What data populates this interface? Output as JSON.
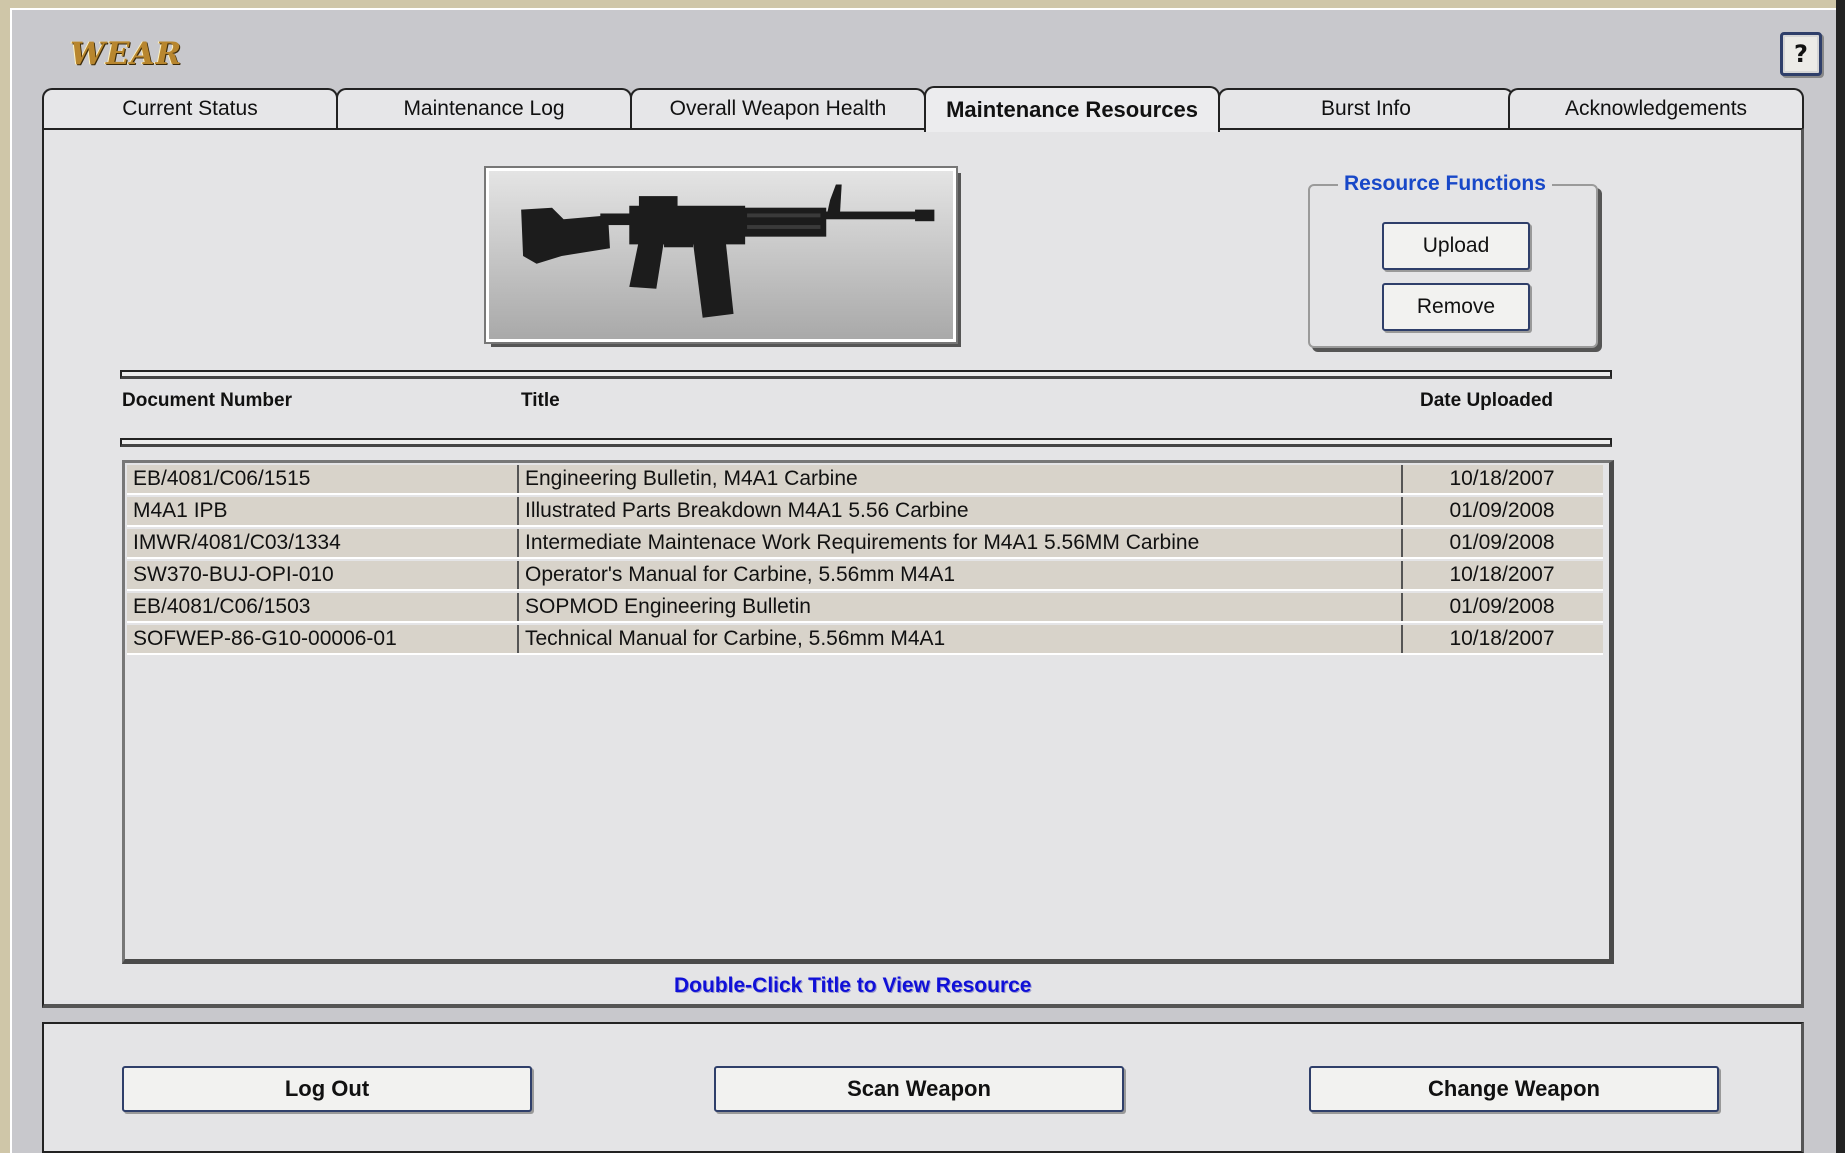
{
  "app": {
    "title": "WEAR",
    "help_label": "?"
  },
  "tabs": [
    {
      "label": "Current Status",
      "active": false
    },
    {
      "label": "Maintenance Log",
      "active": false
    },
    {
      "label": "Overall Weapon Health",
      "active": false
    },
    {
      "label": "Maintenance Resources",
      "active": true
    },
    {
      "label": "Burst Info",
      "active": false
    },
    {
      "label": "Acknowledgements",
      "active": false
    }
  ],
  "resource_functions": {
    "title": "Resource Functions",
    "upload_label": "Upload",
    "remove_label": "Remove"
  },
  "table": {
    "headers": {
      "document_number": "Document Number",
      "title": "Title",
      "date_uploaded": "Date Uploaded"
    },
    "rows": [
      {
        "doc": "EB/4081/C06/1515",
        "title": "Engineering Bulletin, M4A1 Carbine",
        "date": "10/18/2007"
      },
      {
        "doc": "M4A1 IPB",
        "title": "Illustrated Parts Breakdown M4A1 5.56 Carbine",
        "date": "01/09/2008"
      },
      {
        "doc": "IMWR/4081/C03/1334",
        "title": "Intermediate Maintenace Work Requirements for M4A1 5.56MM Carbine",
        "date": "01/09/2008"
      },
      {
        "doc": "SW370-BUJ-OPI-010",
        "title": "Operator's Manual for Carbine, 5.56mm M4A1",
        "date": "10/18/2007"
      },
      {
        "doc": "EB/4081/C06/1503",
        "title": "SOPMOD Engineering Bulletin",
        "date": "01/09/2008"
      },
      {
        "doc": "SOFWEP-86-G10-00006-01",
        "title": "Technical Manual for Carbine, 5.56mm M4A1",
        "date": "10/18/2007"
      }
    ]
  },
  "hint": "Double-Click Title to View Resource",
  "footer": {
    "logout_label": "Log Out",
    "scan_label": "Scan Weapon",
    "change_label": "Change Weapon"
  },
  "colors": {
    "frame": "#c8c8cc",
    "panel": "#e4e4e6",
    "accent_blue": "#1848c8",
    "hint_blue": "#1010d8",
    "title_gold": "#b8862e"
  }
}
